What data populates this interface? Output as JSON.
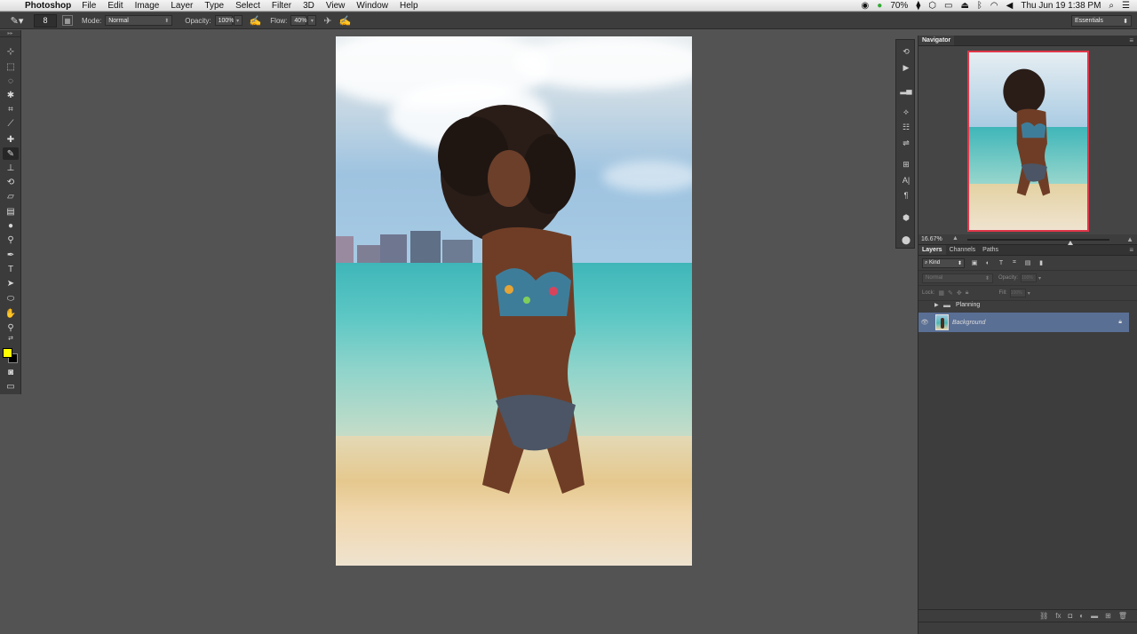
{
  "menubar": {
    "app_name": "Photoshop",
    "items": [
      "File",
      "Edit",
      "Image",
      "Layer",
      "Type",
      "Select",
      "Filter",
      "3D",
      "View",
      "Window",
      "Help"
    ],
    "battery": "70%",
    "clock": "Thu Jun 19  1:38 PM"
  },
  "options": {
    "brush_size": "8",
    "mode_label": "Mode:",
    "mode_value": "Normal",
    "opacity_label": "Opacity:",
    "opacity_value": "100%",
    "flow_label": "Flow:",
    "flow_value": "40%",
    "workspace": "Essentials"
  },
  "navigator": {
    "title": "Navigator",
    "zoom": "16.67%"
  },
  "layers_panel": {
    "tabs": [
      "Layers",
      "Channels",
      "Paths"
    ],
    "kind_filter": "Kind",
    "blend_mode": "Normal",
    "opacity_label": "Opacity:",
    "opacity_value": "100%",
    "lock_label": "Lock:",
    "fill_label": "Fill:",
    "fill_value": "100%",
    "layers": [
      {
        "name": "Planning",
        "type": "group",
        "visible": false
      },
      {
        "name": "Background",
        "type": "image",
        "visible": true,
        "locked": true,
        "selected": true
      }
    ]
  },
  "colors": {
    "foreground": "#ffff00",
    "background": "#000000",
    "selection_highlight": "#5a6f94",
    "navigator_frame": "#e0364a",
    "workspace_bg": "#535353"
  }
}
